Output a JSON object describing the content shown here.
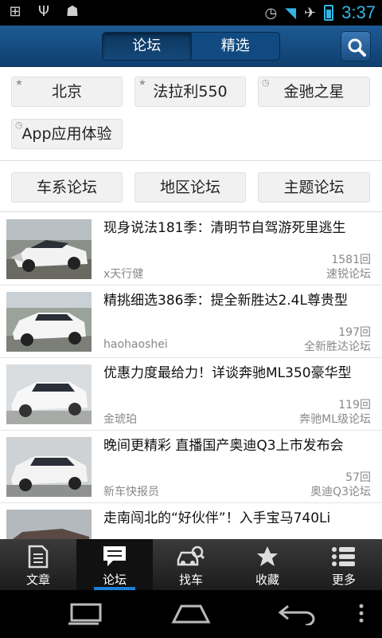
{
  "status": {
    "time": "3:37"
  },
  "header": {
    "tabs": [
      "论坛",
      "精选"
    ]
  },
  "favorites": [
    {
      "label": "北京",
      "mark": "★"
    },
    {
      "label": "法拉利550",
      "mark": "★"
    },
    {
      "label": "金驰之星",
      "mark": "◷"
    },
    {
      "label": "App应用体验",
      "mark": "◷"
    }
  ],
  "categories": [
    "车系论坛",
    "地区论坛",
    "主题论坛"
  ],
  "posts": [
    {
      "title": "现身说法181季：清明节自驾游死里逃生",
      "author": "x天行健",
      "count": "1581回",
      "forum": "速锐论坛"
    },
    {
      "title": "精挑细选386季：提全新胜达2.4L尊贵型",
      "author": "haohaoshei",
      "count": "197回",
      "forum": "全新胜达论坛"
    },
    {
      "title": "优惠力度最给力！详谈奔驰ML350豪华型",
      "author": "金琥珀",
      "count": "119回",
      "forum": "奔驰ML级论坛"
    },
    {
      "title": "晚间更精彩 直播国产奥迪Q3上市发布会",
      "author": "新车快报员",
      "count": "57回",
      "forum": "奥迪Q3论坛"
    },
    {
      "title": "走南闯北的“好伙伴”！入手宝马740Li",
      "author": "",
      "count": "",
      "forum": ""
    }
  ],
  "tabbar": [
    "文章",
    "论坛",
    "找车",
    "收藏",
    "更多"
  ],
  "colors": {
    "header": "#15497b",
    "accent": "#1e7fd8",
    "status_accent": "#33b5e5"
  }
}
